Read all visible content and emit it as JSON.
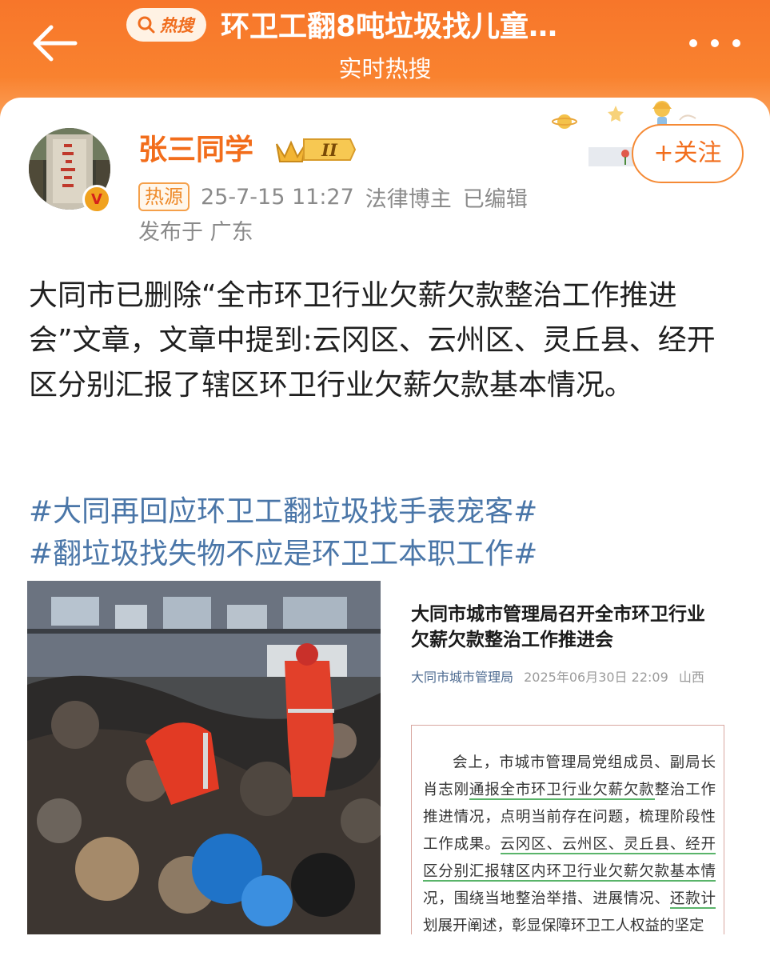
{
  "header": {
    "hot_badge": "热搜",
    "title": "环卫工翻8吨垃圾找儿童…",
    "subtitle": "实时热搜",
    "colors": {
      "top": "#f7762a",
      "bottom": "#fbb06f"
    }
  },
  "post": {
    "username": "张三同学",
    "level": "II",
    "follow_label": "+关注",
    "source_tag": "热源",
    "datetime": "25-7-15 11:27",
    "author_role": "法律博主",
    "edited": "已编辑",
    "location": "发布于 广东",
    "body": "大同市已删除“全市环卫行业欠薪欠款整治工作推进会”文章，文章中提到:云冈区、云州区、灵丘县、经开区分别汇报了辖区环卫行业欠薪欠款基本情况。",
    "hashtags": [
      "#大同再回应环卫工翻垃圾找手表宠客#",
      "#翻垃圾找失物不应是环卫工本职工作#"
    ]
  },
  "article": {
    "title": "大同市城市管理局召开全市环卫行业欠薪欠款整治工作推进会",
    "org": "大同市城市管理局",
    "datetime": "2025年06月30日 22:09",
    "region": "山西",
    "excerpt_parts": [
      "会上，市城市管理局党组成员、副局长肖志刚",
      "通报全市环卫行业欠薪欠款",
      "整治工作推进情况，点明当前存在问题，梳理阶段性工作成果。",
      "云冈区、云州区、灵丘县、经开区分别汇报辖区内环卫行业欠薪欠款基本情",
      "况，围绕当地整治举措、进展情况、",
      "还款计",
      "划展开阐述，彰显保障环卫工人权益的坚定"
    ]
  }
}
